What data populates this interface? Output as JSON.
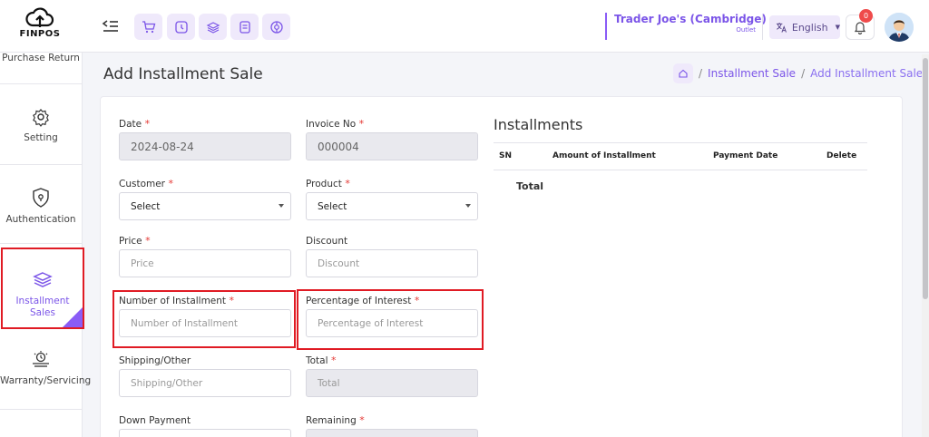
{
  "brand": {
    "logo_text": "FINPOS"
  },
  "header": {
    "store_name": "Trader Joe's (Cambridge)",
    "store_sub": "Outlet",
    "language": "English",
    "notifications": "0",
    "quick_icons": [
      "cart-icon",
      "clock-icon",
      "layers-icon",
      "receipt-icon",
      "globe-icon"
    ]
  },
  "sidebar": {
    "items": [
      {
        "label": "Purchase Return",
        "icon": "return-icon"
      },
      {
        "label": "Setting",
        "icon": "gear-icon"
      },
      {
        "label": "Authentication",
        "icon": "shield-icon"
      },
      {
        "label": "Installment Sales",
        "icon": "stack-icon"
      },
      {
        "label": "Warranty/Servicing",
        "icon": "service-icon"
      }
    ],
    "active_color": "#8a5cf6"
  },
  "page": {
    "title": "Add Installment Sale",
    "breadcrumb": [
      "Installment Sale",
      "Add Installment Sale"
    ]
  },
  "form": {
    "date": {
      "label": "Date",
      "value": "2024-08-24"
    },
    "invoice": {
      "label": "Invoice No",
      "value": "000004"
    },
    "customer": {
      "label": "Customer",
      "value": "Select"
    },
    "product": {
      "label": "Product",
      "value": "Select"
    },
    "price": {
      "label": "Price",
      "placeholder": "Price"
    },
    "discount": {
      "label": "Discount",
      "placeholder": "Discount"
    },
    "num_installment": {
      "label": "Number of Installment",
      "placeholder": "Number of Installment"
    },
    "interest": {
      "label": "Percentage of Interest",
      "placeholder": "Percentage of Interest"
    },
    "shipping": {
      "label": "Shipping/Other",
      "placeholder": "Shipping/Other"
    },
    "total": {
      "label": "Total",
      "placeholder": "Total"
    },
    "down_payment": {
      "label": "Down Payment"
    },
    "remaining": {
      "label": "Remaining"
    }
  },
  "installments": {
    "title": "Installments",
    "columns": [
      "SN",
      "Amount of Installment",
      "Payment Date",
      "Delete"
    ],
    "total_label": "Total"
  },
  "colors": {
    "accent": "#7b55e8",
    "highlight": "#e01b24"
  }
}
